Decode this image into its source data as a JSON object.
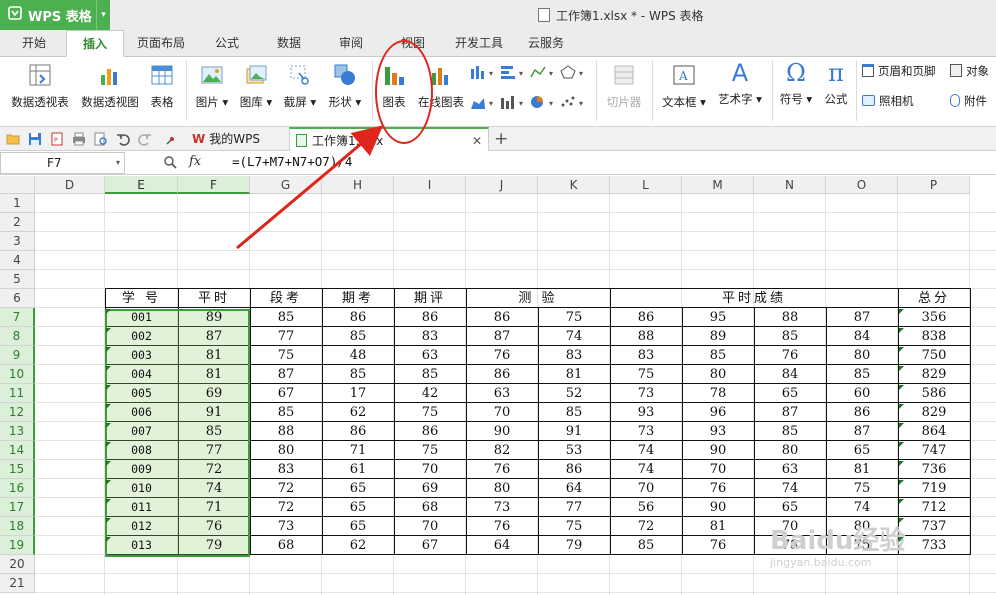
{
  "app": {
    "brand": "WPS 表格",
    "window_title": "工作簿1.xlsx * - WPS 表格"
  },
  "menu_tabs": [
    "开始",
    "插入",
    "页面布局",
    "公式",
    "数据",
    "审阅",
    "视图",
    "开发工具",
    "云服务"
  ],
  "active_tab": "插入",
  "ribbon": {
    "pivot_table": "数据透视表",
    "pivot_chart": "数据透视图",
    "table": "表格",
    "picture": "图片",
    "gallery": "图库",
    "screenshot": "截屏",
    "shapes": "形状",
    "chart": "图表",
    "online_chart": "在线图表",
    "slicer": "切片器",
    "textbox": "文本框",
    "wordart": "艺术字",
    "symbol": "符号",
    "equation": "公式",
    "header_footer": "页眉和页脚",
    "object": "对象",
    "camera": "照相机",
    "attachment": "附件"
  },
  "doc_tabs": {
    "mywps": "我的WPS",
    "workbook": "工作簿1.xlsx"
  },
  "formula_bar": {
    "cell_ref": "F7",
    "fx": "fx",
    "formula": "=(L7+M7+N7+O7)/4"
  },
  "columns": [
    "D",
    "E",
    "F",
    "G",
    "H",
    "I",
    "J",
    "K",
    "L",
    "M",
    "N",
    "O",
    "P"
  ],
  "rows": [
    "1",
    "2",
    "3",
    "4",
    "5",
    "6",
    "7",
    "8",
    "9",
    "10",
    "11",
    "12",
    "13",
    "14",
    "15",
    "16",
    "17",
    "18",
    "19",
    "20",
    "21"
  ],
  "table_headers": {
    "id": "学 号",
    "avg": "平时",
    "duan": "段考",
    "qi": "期考",
    "ping": "期评",
    "test": "测    验",
    "usual": "平时成绩",
    "total": "总分"
  },
  "table_rows": [
    [
      "001",
      "89",
      "85",
      "86",
      "86",
      "86",
      "75",
      "86",
      "95",
      "88",
      "87",
      "356"
    ],
    [
      "002",
      "87",
      "77",
      "85",
      "83",
      "87",
      "74",
      "88",
      "89",
      "85",
      "84",
      "838"
    ],
    [
      "003",
      "81",
      "75",
      "48",
      "63",
      "76",
      "83",
      "83",
      "85",
      "76",
      "80",
      "750"
    ],
    [
      "004",
      "81",
      "87",
      "85",
      "85",
      "86",
      "81",
      "75",
      "80",
      "84",
      "85",
      "829"
    ],
    [
      "005",
      "69",
      "67",
      "17",
      "42",
      "63",
      "52",
      "73",
      "78",
      "65",
      "60",
      "586"
    ],
    [
      "006",
      "91",
      "85",
      "62",
      "75",
      "70",
      "85",
      "93",
      "96",
      "87",
      "86",
      "829"
    ],
    [
      "007",
      "85",
      "88",
      "86",
      "86",
      "90",
      "91",
      "73",
      "93",
      "85",
      "87",
      "864"
    ],
    [
      "008",
      "77",
      "80",
      "71",
      "75",
      "82",
      "53",
      "74",
      "90",
      "80",
      "65",
      "747"
    ],
    [
      "009",
      "72",
      "83",
      "61",
      "70",
      "76",
      "86",
      "74",
      "70",
      "63",
      "81",
      "736"
    ],
    [
      "010",
      "74",
      "72",
      "65",
      "69",
      "80",
      "64",
      "70",
      "76",
      "74",
      "75",
      "719"
    ],
    [
      "011",
      "71",
      "72",
      "65",
      "68",
      "73",
      "77",
      "56",
      "90",
      "65",
      "74",
      "712"
    ],
    [
      "012",
      "76",
      "73",
      "65",
      "70",
      "76",
      "75",
      "72",
      "81",
      "70",
      "80",
      "737"
    ],
    [
      "013",
      "79",
      "68",
      "62",
      "67",
      "64",
      "79",
      "85",
      "76",
      "78",
      "75",
      "733"
    ]
  ],
  "watermark": {
    "text": "Baidu经验",
    "sub": "jingyan.baidu.com"
  },
  "colors": {
    "brand_green": "#4caf50",
    "selection_green": "#3d9a3d",
    "annotation_red": "#e0261c"
  }
}
